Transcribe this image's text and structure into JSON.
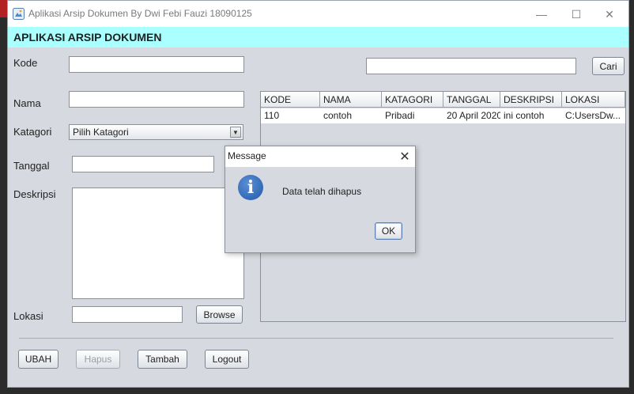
{
  "window": {
    "title": "Aplikasi Arsip Dokumen By Dwi Febi Fauzi 18090125",
    "minimize_glyph": "—",
    "maximize_glyph": "☐",
    "close_glyph": "✕"
  },
  "header": {
    "title": "APLIKASI ARSIP DOKUMEN"
  },
  "form": {
    "kode_label": "Kode",
    "kode_value": "",
    "nama_label": "Nama",
    "nama_value": "",
    "katagori_label": "Katagori",
    "katagori_selected": "Pilih Katagori",
    "tanggal_label": "Tanggal",
    "tanggal_value": "",
    "deskripsi_label": "Deskripsi",
    "deskripsi_value": "",
    "lokasi_label": "Lokasi",
    "lokasi_value": "",
    "browse_label": "Browse"
  },
  "search": {
    "value": "",
    "button_label": "Cari"
  },
  "table": {
    "columns": [
      "KODE",
      "NAMA",
      "KATAGORI",
      "TANGGAL",
      "DESKRIPSI",
      "LOKASI"
    ],
    "rows": [
      [
        "110",
        "contoh",
        "Pribadi",
        "20 April 2020",
        "ini contoh",
        "C:UsersDw..."
      ]
    ]
  },
  "actions": {
    "ubah": "UBAH",
    "hapus": "Hapus",
    "tambah": "Tambah",
    "logout": "Logout"
  },
  "dialog": {
    "title": "Message",
    "message": "Data telah dihapus",
    "icon_glyph": "i",
    "close_glyph": "✕",
    "ok_label": "OK"
  },
  "icons": {
    "app": "app-icon",
    "info": "info-icon",
    "dropdown": "chevron-down-icon"
  },
  "colors": {
    "header_band": "#aaffff",
    "panel_bg": "#d6d9df",
    "info_blue": "#1f5aa8"
  }
}
